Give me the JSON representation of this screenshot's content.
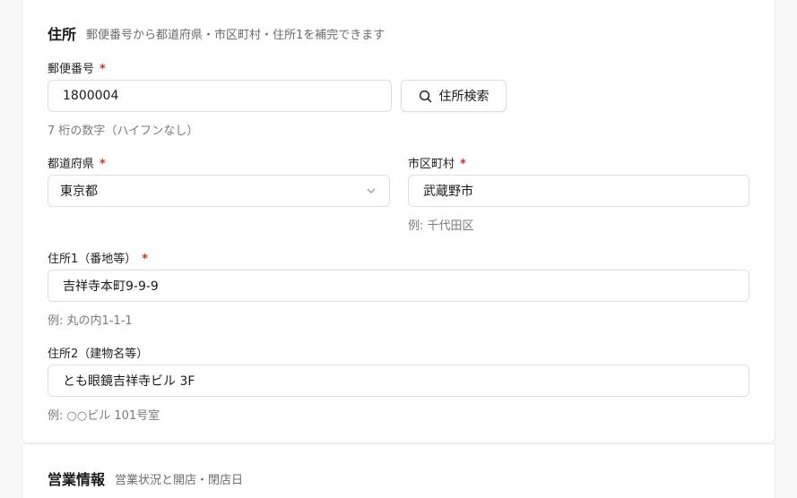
{
  "address_section": {
    "title": "住所",
    "description": "郵便番号から都道府県・市区町村・住所1を補完できます",
    "postal": {
      "label": "郵便番号",
      "required_mark": "*",
      "value": "1800004",
      "hint": "7 桁の数字（ハイフンなし）"
    },
    "search_button": {
      "label": "住所検索",
      "icon": "search-icon"
    },
    "prefecture": {
      "label": "都道府県",
      "required_mark": "*",
      "selected": "東京都",
      "icon": "chevron-down-icon"
    },
    "city": {
      "label": "市区町村",
      "required_mark": "*",
      "value": "武蔵野市",
      "hint": "例: 千代田区"
    },
    "address1": {
      "label": "住所1（番地等）",
      "required_mark": "*",
      "value": "吉祥寺本町9-9-9",
      "hint": "例: 丸の内1-1-1"
    },
    "address2": {
      "label": "住所2（建物名等）",
      "value": "とも眼鏡吉祥寺ビル 3F",
      "hint": "例: ○○ビル 101号室"
    }
  },
  "business_section": {
    "title": "営業情報",
    "description": "営業状況と開店・閉店日"
  },
  "colors": {
    "required": "#d92d2d",
    "border": "#dedede",
    "hint": "#7a7a7a"
  }
}
